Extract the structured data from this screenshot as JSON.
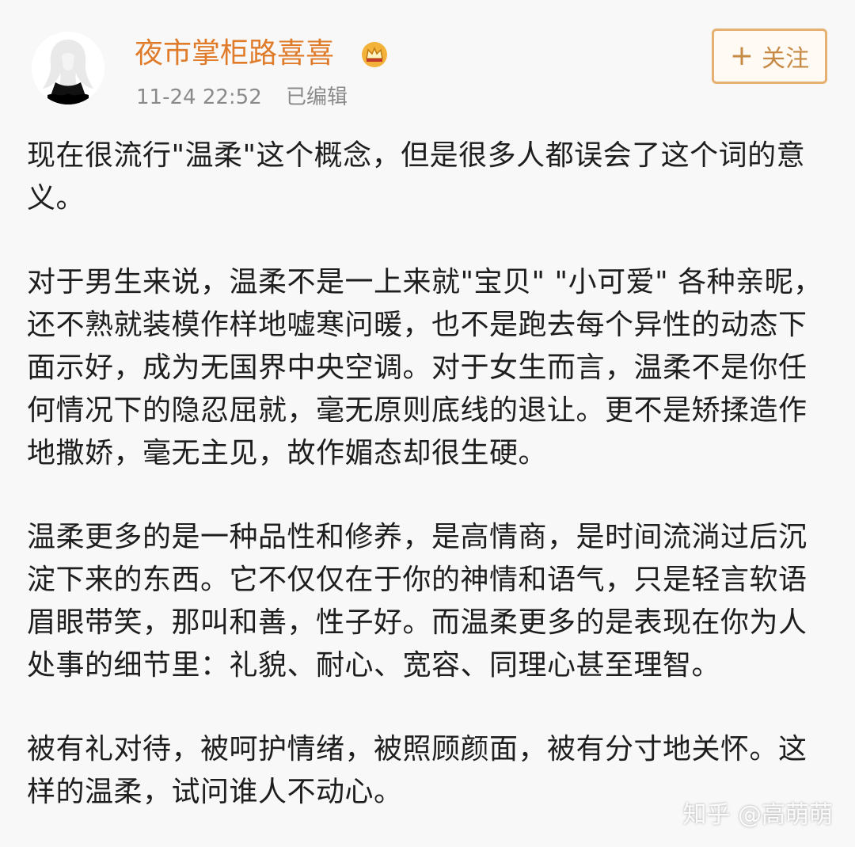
{
  "post": {
    "author": "夜市掌柜路喜喜",
    "badge_icon": "crown-icon",
    "timestamp": "11-24 22:52",
    "edited_label": "已编辑",
    "follow_label": "关注",
    "follow_icon": "plus-icon"
  },
  "paragraphs": [
    "现在很流行\"温柔\"这个概念，但是很多人都误会了这个词的意义。",
    "对于男生来说，温柔不是一上来就\"宝贝\" \"小可爱\" 各种亲昵，还不熟就装模作样地嘘寒问暖，也不是跑去每个异性的动态下面示好，成为无国界中央空调。对于女生而言，温柔不是你任何情况下的隐忍屈就，毫无原则底线的退让。更不是矫揉造作地撒娇，毫无主见，故作媚态却很生硬。",
    "温柔更多的是一种品性和修养，是高情商，是时间流淌过后沉淀下来的东西。它不仅仅在于你的神情和语气，只是轻言软语眉眼带笑，那叫和善，性子好。而温柔更多的是表现在你为人处事的细节里：礼貌、耐心、宽容、同理心甚至理智。",
    "被有礼对待，被呵护情绪，被照顾颜面，被有分寸地关怀。这样的温柔，试问谁人不动心。"
  ],
  "watermark": "知乎 @高萌萌",
  "colors": {
    "author": "#e07b2a",
    "meta": "#8a8a8a",
    "follow_border": "#e5b070",
    "follow_text": "#c68a45",
    "background": "#f8f8f8"
  }
}
